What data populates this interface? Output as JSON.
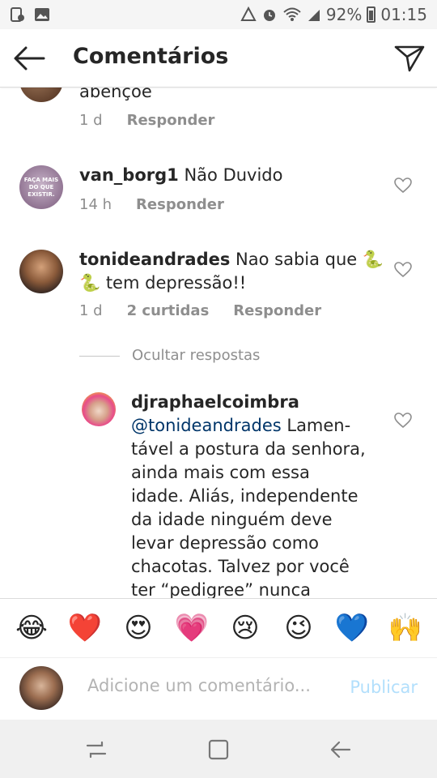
{
  "status_bar": {
    "battery": "92%",
    "time": "01:15"
  },
  "header": {
    "title": "Comentários"
  },
  "comments": [
    {
      "text": "abençoe",
      "time": "1 d",
      "reply": "Responder"
    },
    {
      "username": "van_borg1",
      "text": "Não Duvido",
      "avatar_text": "FAÇA MAIS DO QUE EXISTIR.",
      "time": "14 h",
      "reply": "Responder"
    },
    {
      "username": "tonideandrades",
      "line1": "Nao sabia que 🐍",
      "line2": "🐍 tem depressão!!",
      "time": "1 d",
      "likes": "2 curtidas",
      "reply": "Responder"
    }
  ],
  "hide_replies": "Ocultar respostas",
  "reply": {
    "username": "djraphaelcoimbra",
    "mention": "@tonideandrades",
    "lines": [
      " Lamen-",
      "tável a postura da senhora,",
      "ainda mais com essa",
      "idade. Aliás, independente",
      "da idade ninguém deve",
      "levar depressão como",
      "chacotas. Talvez por você",
      "ter “pedigree” nunca passou"
    ]
  },
  "emoji_bar": [
    "😂",
    "❤️",
    "😍",
    "💗",
    "😢",
    "😉",
    "💙",
    "🙌"
  ],
  "comment_input": {
    "placeholder": "Adicione um comentário...",
    "value": ""
  },
  "publish": "Publicar",
  "colors": {
    "link": "#003569",
    "muted": "#8e8e8e",
    "publish_disabled": "#b2dffc"
  }
}
